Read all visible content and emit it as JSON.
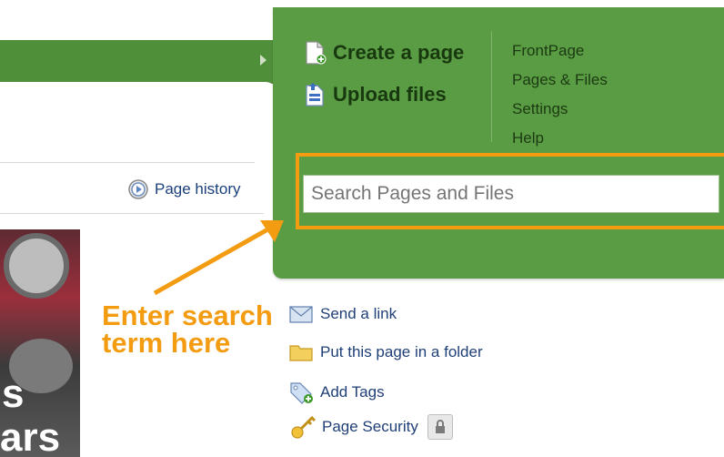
{
  "header": {
    "create_page": "Create a page",
    "upload_files": "Upload files",
    "nav": [
      "FrontPage",
      "Pages & Files",
      "Settings",
      "Help"
    ]
  },
  "search": {
    "placeholder": "Search Pages and Files"
  },
  "page_history": "Page history",
  "side_actions": [
    {
      "label": "Send a link",
      "icon": "envelope-icon"
    },
    {
      "label": "Put this page in a folder",
      "icon": "folder-icon"
    },
    {
      "label": "Add Tags",
      "icon": "tag-icon"
    },
    {
      "label": "Page Security",
      "icon": "key-icon"
    }
  ],
  "annotation": {
    "line1": "Enter search",
    "line2": "term here"
  },
  "thumbnail": {
    "text1": "s",
    "text2": "ars"
  },
  "colors": {
    "green_panel": "#5a9c44",
    "tab_green": "#4f8f3a",
    "highlight": "#f39c12",
    "link_blue": "#1f3f77"
  }
}
